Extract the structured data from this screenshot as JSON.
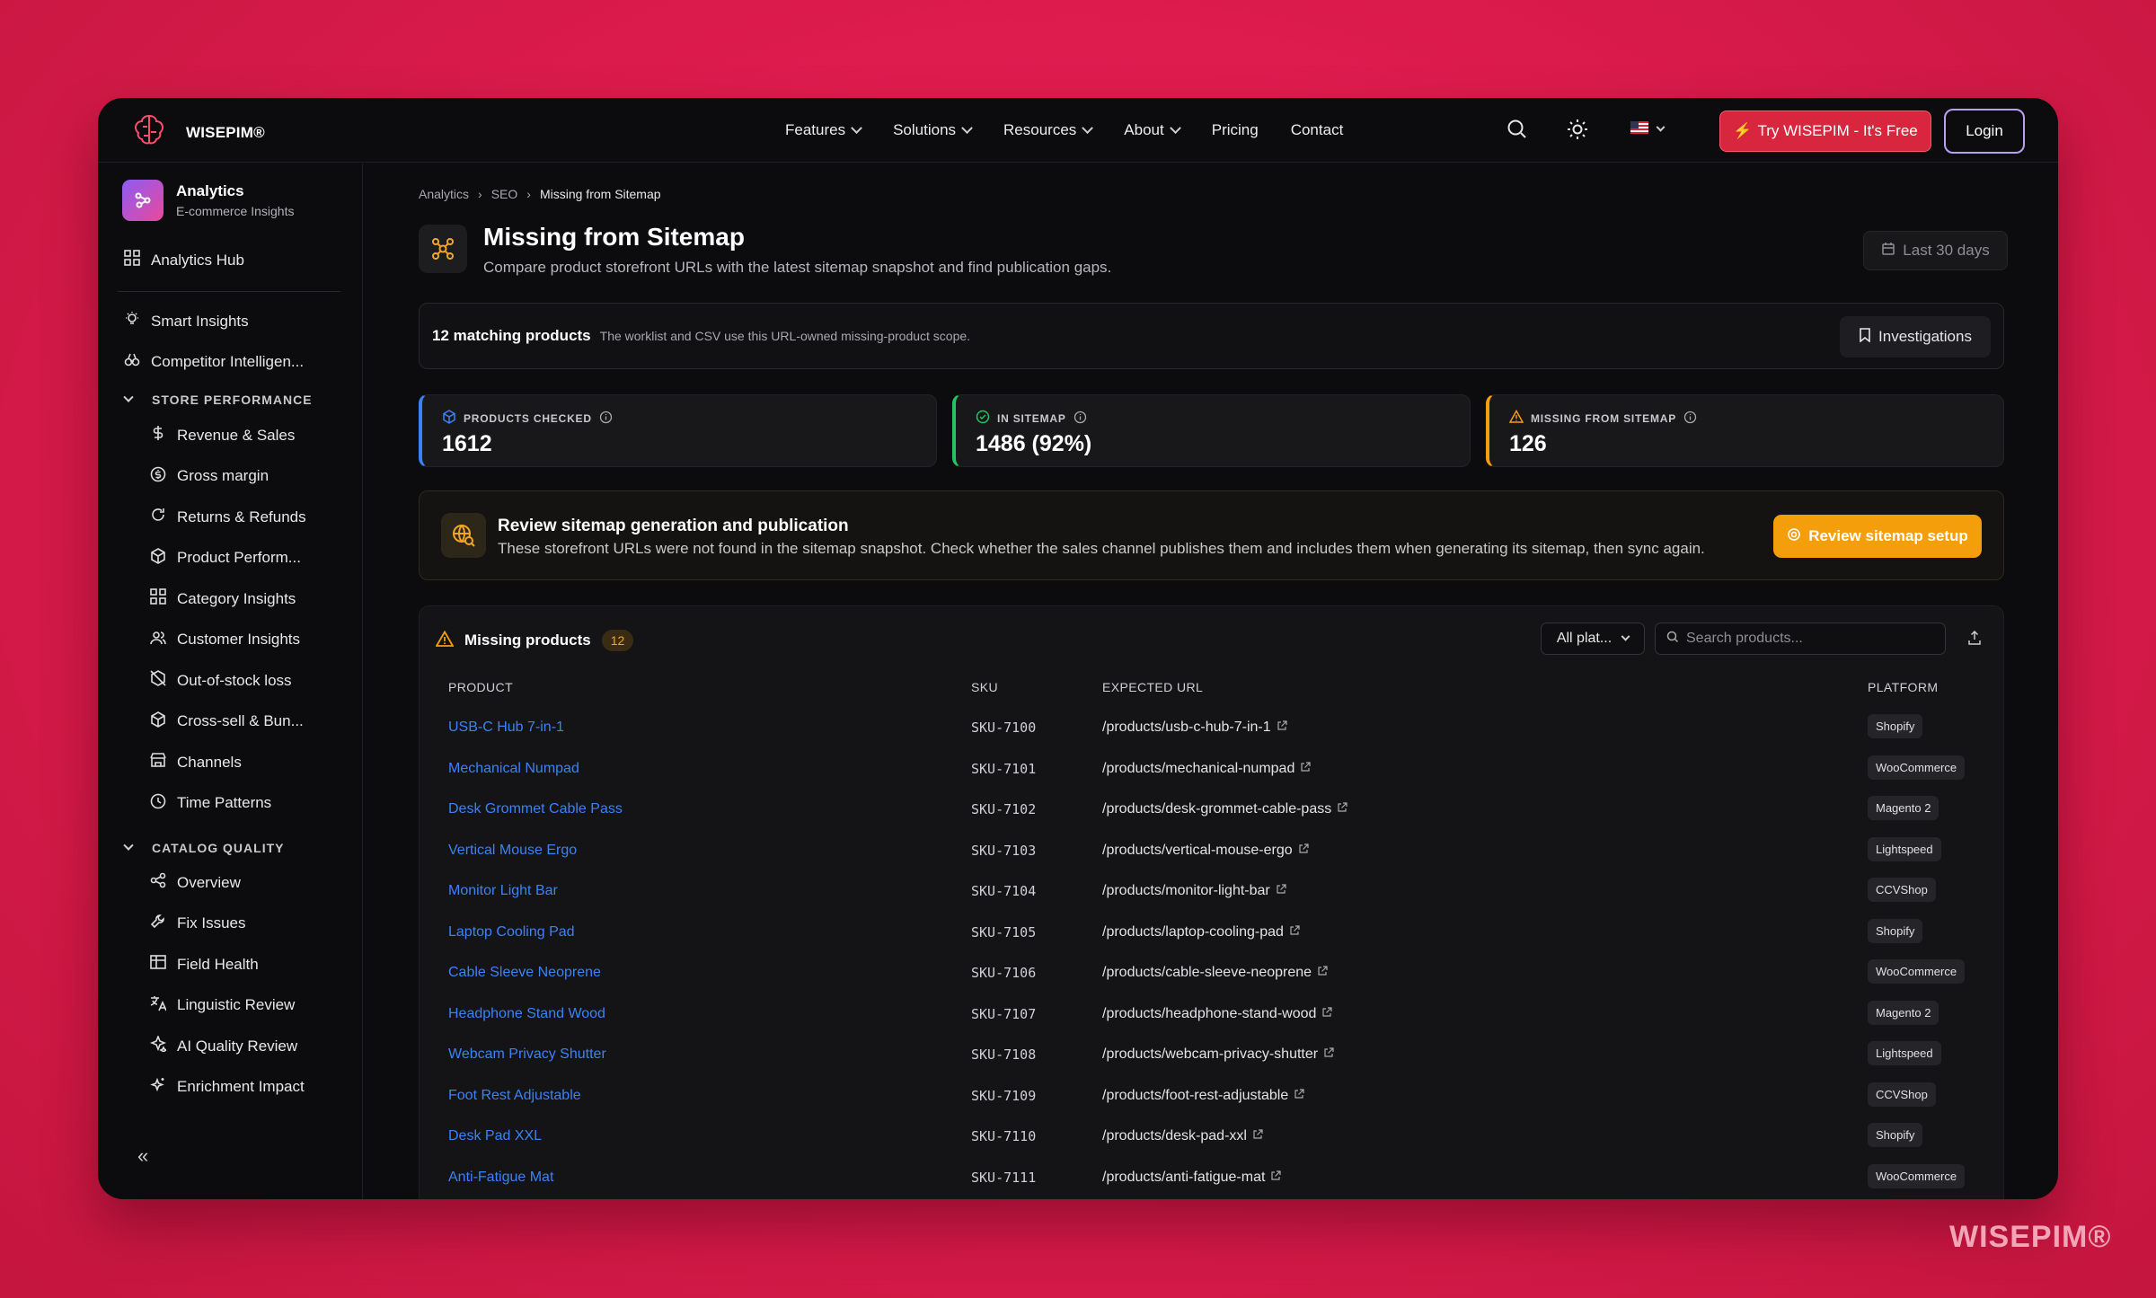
{
  "brand": {
    "name": "WISEPIM®"
  },
  "nav": {
    "items": [
      "Features",
      "Solutions",
      "Resources",
      "About",
      "Pricing",
      "Contact"
    ],
    "try_label": "Try WISEPIM - It's Free",
    "login_label": "Login"
  },
  "sidebar": {
    "app_title": "Analytics",
    "app_subtitle": "E-commerce Insights",
    "hub": "Analytics Hub",
    "top_items": [
      "Smart Insights",
      "Competitor Intelligen..."
    ],
    "store_section": "STORE PERFORMANCE",
    "store_items": [
      "Revenue & Sales",
      "Gross margin",
      "Returns & Refunds",
      "Product Perform...",
      "Category Insights",
      "Customer Insights",
      "Out-of-stock loss",
      "Cross-sell & Bun...",
      "Channels",
      "Time Patterns"
    ],
    "catalog_section": "CATALOG QUALITY",
    "catalog_items": [
      "Overview",
      "Fix Issues",
      "Field Health",
      "Linguistic Review",
      "AI Quality Review",
      "Enrichment Impact"
    ],
    "collapse": "«"
  },
  "breadcrumb": [
    "Analytics",
    "SEO",
    "Missing from Sitemap"
  ],
  "page": {
    "title": "Missing from Sitemap",
    "subtitle": "Compare product storefront URLs with the latest sitemap snapshot and find publication gaps.",
    "date_range": "Last 30 days"
  },
  "scope": {
    "count_label": "12 matching products",
    "note": "The worklist and CSV use this URL-owned missing-product scope.",
    "investigations_label": "Investigations"
  },
  "stats": [
    {
      "label": "PRODUCTS CHECKED",
      "value": "1612",
      "color": "#3b82f6"
    },
    {
      "label": "IN SITEMAP",
      "value": "1486 (92%)",
      "color": "#22c55e"
    },
    {
      "label": "MISSING FROM SITEMAP",
      "value": "126",
      "color": "#f59e0b"
    }
  ],
  "alert": {
    "title": "Review sitemap generation and publication",
    "desc": "These storefront URLs were not found in the sitemap snapshot. Check whether the sales channel publishes them and includes them when generating its sitemap, then sync again.",
    "button": "Review sitemap setup"
  },
  "table": {
    "title": "Missing products",
    "count": "12",
    "filter": "All plat...",
    "search_placeholder": "Search products...",
    "columns": [
      "PRODUCT",
      "SKU",
      "EXPECTED URL",
      "PLATFORM"
    ],
    "rows": [
      {
        "name": "USB-C Hub 7-in-1",
        "sku": "SKU-7100",
        "url": "/products/usb-c-hub-7-in-1",
        "platform": "Shopify"
      },
      {
        "name": "Mechanical Numpad",
        "sku": "SKU-7101",
        "url": "/products/mechanical-numpad",
        "platform": "WooCommerce"
      },
      {
        "name": "Desk Grommet Cable Pass",
        "sku": "SKU-7102",
        "url": "/products/desk-grommet-cable-pass",
        "platform": "Magento 2"
      },
      {
        "name": "Vertical Mouse Ergo",
        "sku": "SKU-7103",
        "url": "/products/vertical-mouse-ergo",
        "platform": "Lightspeed"
      },
      {
        "name": "Monitor Light Bar",
        "sku": "SKU-7104",
        "url": "/products/monitor-light-bar",
        "platform": "CCVShop"
      },
      {
        "name": "Laptop Cooling Pad",
        "sku": "SKU-7105",
        "url": "/products/laptop-cooling-pad",
        "platform": "Shopify"
      },
      {
        "name": "Cable Sleeve Neoprene",
        "sku": "SKU-7106",
        "url": "/products/cable-sleeve-neoprene",
        "platform": "WooCommerce"
      },
      {
        "name": "Headphone Stand Wood",
        "sku": "SKU-7107",
        "url": "/products/headphone-stand-wood",
        "platform": "Magento 2"
      },
      {
        "name": "Webcam Privacy Shutter",
        "sku": "SKU-7108",
        "url": "/products/webcam-privacy-shutter",
        "platform": "Lightspeed"
      },
      {
        "name": "Foot Rest Adjustable",
        "sku": "SKU-7109",
        "url": "/products/foot-rest-adjustable",
        "platform": "CCVShop"
      },
      {
        "name": "Desk Pad XXL",
        "sku": "SKU-7110",
        "url": "/products/desk-pad-xxl",
        "platform": "Shopify"
      },
      {
        "name": "Anti-Fatigue Mat",
        "sku": "SKU-7111",
        "url": "/products/anti-fatigue-mat",
        "platform": "WooCommerce"
      }
    ]
  },
  "watermark": "WISEPIM®"
}
